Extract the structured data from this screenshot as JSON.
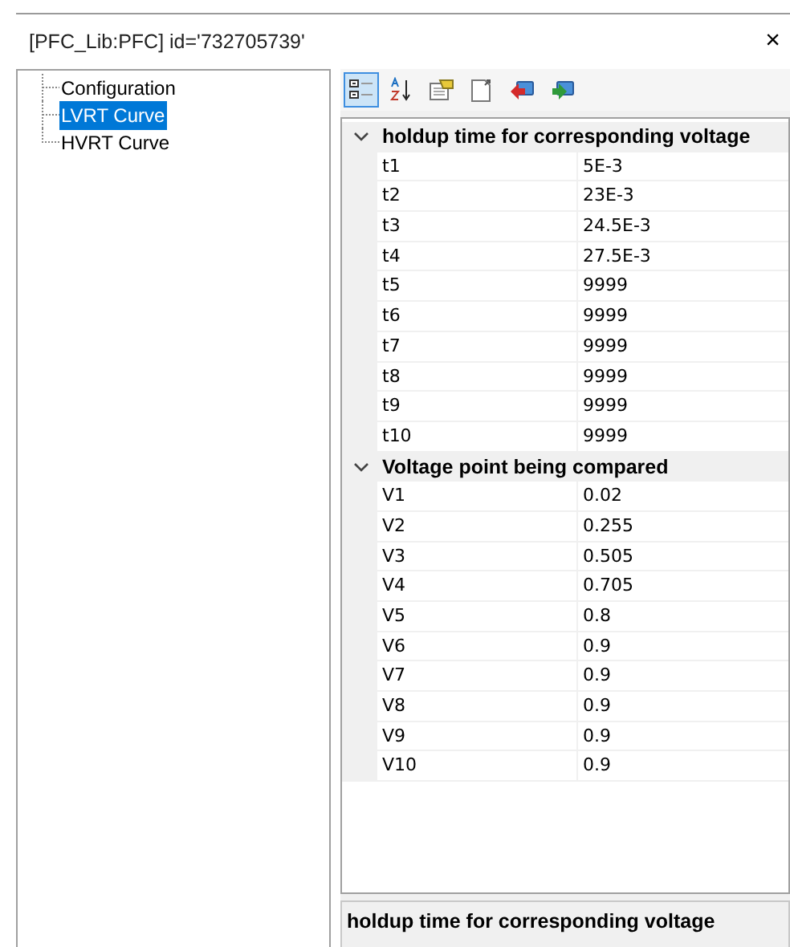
{
  "window": {
    "title": "[PFC_Lib:PFC] id='732705739'",
    "close": "×"
  },
  "tree": {
    "items": [
      {
        "label": "Configuration",
        "selected": false
      },
      {
        "label": "LVRT Curve",
        "selected": true
      },
      {
        "label": "HVRT Curve",
        "selected": false
      }
    ]
  },
  "toolbar": [
    {
      "kind": "categorized",
      "selected": true
    },
    {
      "kind": "alphabetical",
      "selected": false
    },
    {
      "kind": "pages",
      "selected": false
    },
    {
      "kind": "export",
      "selected": false
    },
    {
      "kind": "back",
      "selected": false
    },
    {
      "kind": "forward",
      "selected": false
    }
  ],
  "grid": {
    "categories": [
      {
        "title": "holdup time for corresponding voltage",
        "expanded": true,
        "properties": [
          {
            "name": "t1",
            "value": "5E-3"
          },
          {
            "name": "t2",
            "value": "23E-3"
          },
          {
            "name": "t3",
            "value": "24.5E-3"
          },
          {
            "name": "t4",
            "value": "27.5E-3"
          },
          {
            "name": "t5",
            "value": "9999"
          },
          {
            "name": "t6",
            "value": "9999"
          },
          {
            "name": "t7",
            "value": "9999"
          },
          {
            "name": "t8",
            "value": "9999"
          },
          {
            "name": "t9",
            "value": "9999"
          },
          {
            "name": "t10",
            "value": "9999"
          }
        ]
      },
      {
        "title": "Voltage point being compared",
        "expanded": true,
        "properties": [
          {
            "name": "V1",
            "value": "0.02"
          },
          {
            "name": "V2",
            "value": "0.255"
          },
          {
            "name": "V3",
            "value": "0.505"
          },
          {
            "name": "V4",
            "value": "0.705"
          },
          {
            "name": "V5",
            "value": "0.8"
          },
          {
            "name": "V6",
            "value": "0.9"
          },
          {
            "name": "V7",
            "value": "0.9"
          },
          {
            "name": "V8",
            "value": "0.9"
          },
          {
            "name": "V9",
            "value": "0.9"
          },
          {
            "name": "V10",
            "value": "0.9"
          }
        ]
      }
    ]
  },
  "description": {
    "title": "holdup time for corresponding voltage"
  }
}
